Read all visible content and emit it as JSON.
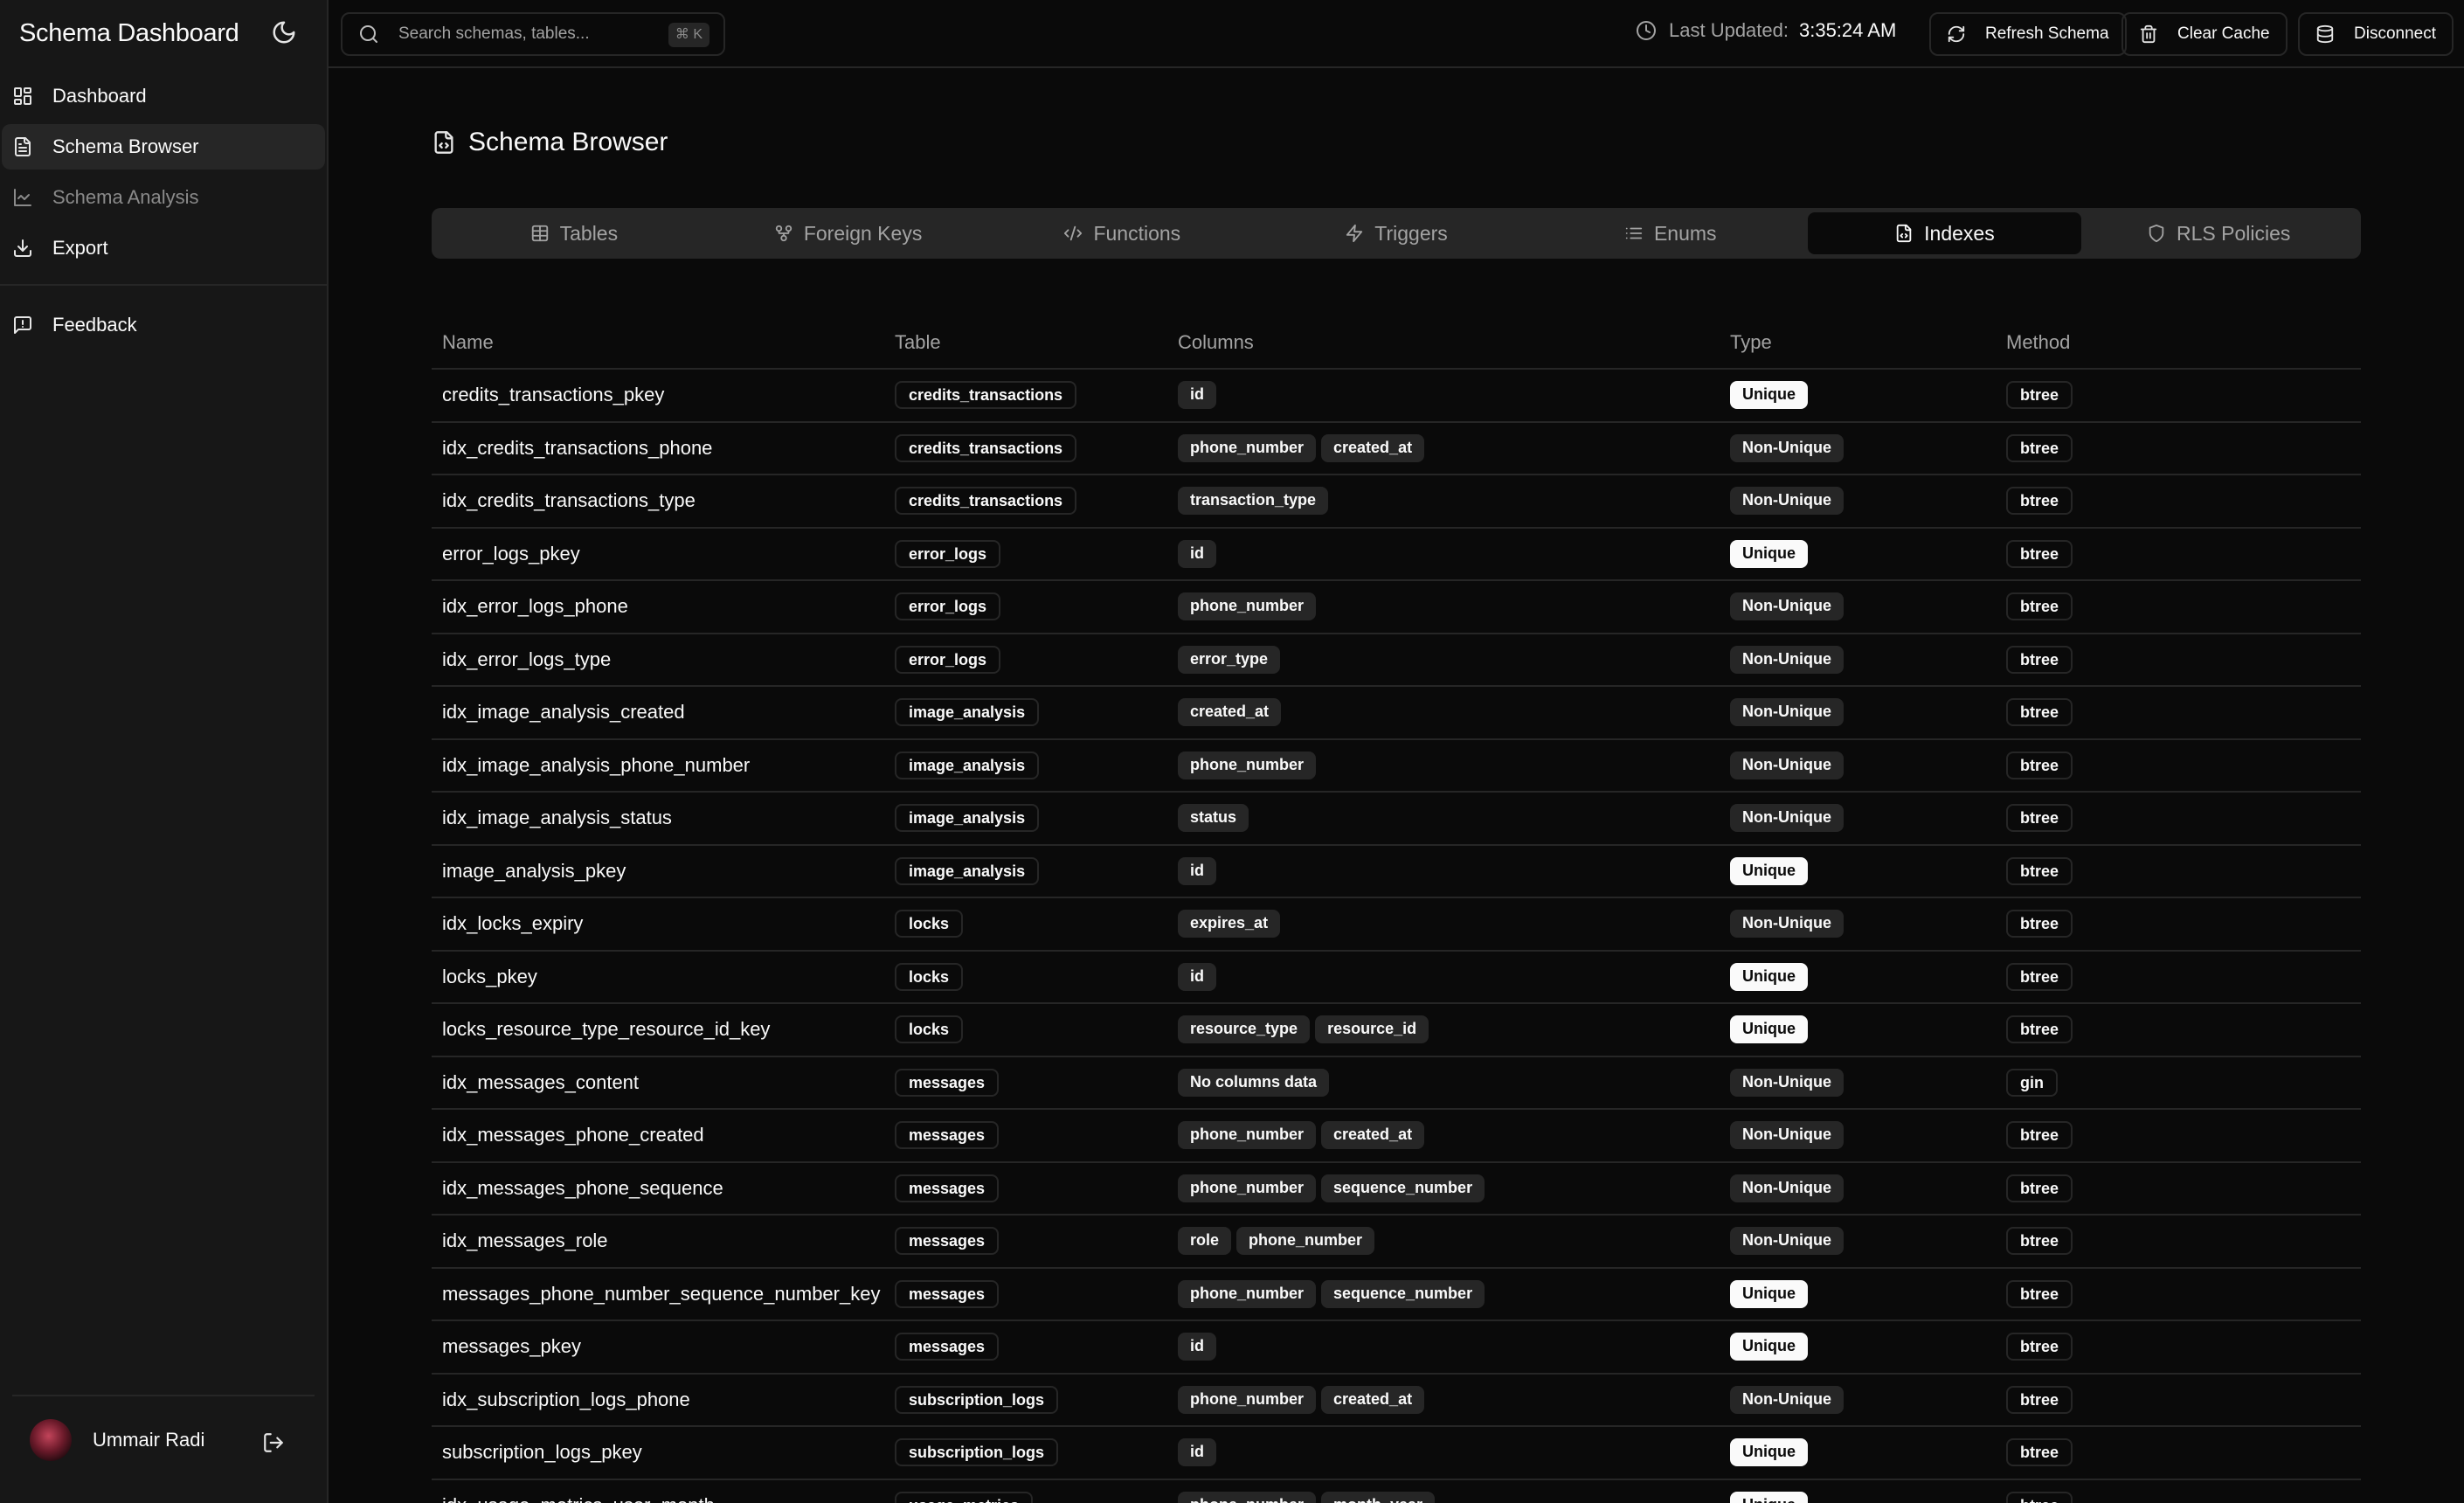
{
  "app": {
    "title": "Schema Dashboard"
  },
  "sidebar": {
    "items": [
      {
        "label": "Dashboard",
        "icon": "dashboard-icon"
      },
      {
        "label": "Schema Browser",
        "icon": "file-text-icon",
        "active": true
      },
      {
        "label": "Schema Analysis",
        "icon": "line-chart-icon",
        "muted": true
      },
      {
        "label": "Export",
        "icon": "download-icon"
      }
    ],
    "feedback": {
      "label": "Feedback",
      "icon": "message-square-icon"
    },
    "user": {
      "name": "Ummair Radi"
    }
  },
  "topbar": {
    "search_placeholder": "Search schemas, tables...",
    "search_shortcut": "⌘ K",
    "last_updated_label": "Last Updated:",
    "last_updated_time": "3:35:24 AM",
    "buttons": {
      "refresh": "Refresh Schema",
      "clear_cache": "Clear Cache",
      "disconnect": "Disconnect"
    }
  },
  "main": {
    "title": "Schema Browser",
    "tabs": [
      {
        "label": "Tables",
        "icon": "table-icon"
      },
      {
        "label": "Foreign Keys",
        "icon": "git-fork-icon"
      },
      {
        "label": "Functions",
        "icon": "code-icon"
      },
      {
        "label": "Triggers",
        "icon": "zap-icon"
      },
      {
        "label": "Enums",
        "icon": "list-icon"
      },
      {
        "label": "Indexes",
        "icon": "file-code-icon",
        "active": true
      },
      {
        "label": "RLS Policies",
        "icon": "shield-icon"
      }
    ],
    "table": {
      "headers": [
        "Name",
        "Table",
        "Columns",
        "Type",
        "Method"
      ],
      "rows": [
        {
          "name": "credits_transactions_pkey",
          "table": "credits_transactions",
          "columns": [
            "id"
          ],
          "type": "Unique",
          "method": "btree"
        },
        {
          "name": "idx_credits_transactions_phone",
          "table": "credits_transactions",
          "columns": [
            "phone_number",
            "created_at"
          ],
          "type": "Non-Unique",
          "method": "btree"
        },
        {
          "name": "idx_credits_transactions_type",
          "table": "credits_transactions",
          "columns": [
            "transaction_type"
          ],
          "type": "Non-Unique",
          "method": "btree"
        },
        {
          "name": "error_logs_pkey",
          "table": "error_logs",
          "columns": [
            "id"
          ],
          "type": "Unique",
          "method": "btree"
        },
        {
          "name": "idx_error_logs_phone",
          "table": "error_logs",
          "columns": [
            "phone_number"
          ],
          "type": "Non-Unique",
          "method": "btree"
        },
        {
          "name": "idx_error_logs_type",
          "table": "error_logs",
          "columns": [
            "error_type"
          ],
          "type": "Non-Unique",
          "method": "btree"
        },
        {
          "name": "idx_image_analysis_created",
          "table": "image_analysis",
          "columns": [
            "created_at"
          ],
          "type": "Non-Unique",
          "method": "btree"
        },
        {
          "name": "idx_image_analysis_phone_number",
          "table": "image_analysis",
          "columns": [
            "phone_number"
          ],
          "type": "Non-Unique",
          "method": "btree"
        },
        {
          "name": "idx_image_analysis_status",
          "table": "image_analysis",
          "columns": [
            "status"
          ],
          "type": "Non-Unique",
          "method": "btree"
        },
        {
          "name": "image_analysis_pkey",
          "table": "image_analysis",
          "columns": [
            "id"
          ],
          "type": "Unique",
          "method": "btree"
        },
        {
          "name": "idx_locks_expiry",
          "table": "locks",
          "columns": [
            "expires_at"
          ],
          "type": "Non-Unique",
          "method": "btree"
        },
        {
          "name": "locks_pkey",
          "table": "locks",
          "columns": [
            "id"
          ],
          "type": "Unique",
          "method": "btree"
        },
        {
          "name": "locks_resource_type_resource_id_key",
          "table": "locks",
          "columns": [
            "resource_type",
            "resource_id"
          ],
          "type": "Unique",
          "method": "btree"
        },
        {
          "name": "idx_messages_content",
          "table": "messages",
          "columns": [
            "No columns data"
          ],
          "type": "Non-Unique",
          "method": "gin"
        },
        {
          "name": "idx_messages_phone_created",
          "table": "messages",
          "columns": [
            "phone_number",
            "created_at"
          ],
          "type": "Non-Unique",
          "method": "btree"
        },
        {
          "name": "idx_messages_phone_sequence",
          "table": "messages",
          "columns": [
            "phone_number",
            "sequence_number"
          ],
          "type": "Non-Unique",
          "method": "btree"
        },
        {
          "name": "idx_messages_role",
          "table": "messages",
          "columns": [
            "role",
            "phone_number"
          ],
          "type": "Non-Unique",
          "method": "btree"
        },
        {
          "name": "messages_phone_number_sequence_number_key",
          "table": "messages",
          "columns": [
            "phone_number",
            "sequence_number"
          ],
          "type": "Unique",
          "method": "btree"
        },
        {
          "name": "messages_pkey",
          "table": "messages",
          "columns": [
            "id"
          ],
          "type": "Unique",
          "method": "btree"
        },
        {
          "name": "idx_subscription_logs_phone",
          "table": "subscription_logs",
          "columns": [
            "phone_number",
            "created_at"
          ],
          "type": "Non-Unique",
          "method": "btree"
        },
        {
          "name": "subscription_logs_pkey",
          "table": "subscription_logs",
          "columns": [
            "id"
          ],
          "type": "Unique",
          "method": "btree"
        },
        {
          "name": "idx_usage_metrics_user_month",
          "table": "usage_metrics",
          "columns": [
            "phone_number",
            "month_year"
          ],
          "type": "Unique",
          "method": "btree"
        }
      ]
    }
  },
  "colors": {
    "background": "#0a0a0a",
    "sidebar": "#171717",
    "border": "#262626",
    "muted_text": "#a3a3a3",
    "foreground": "#fafafa"
  }
}
